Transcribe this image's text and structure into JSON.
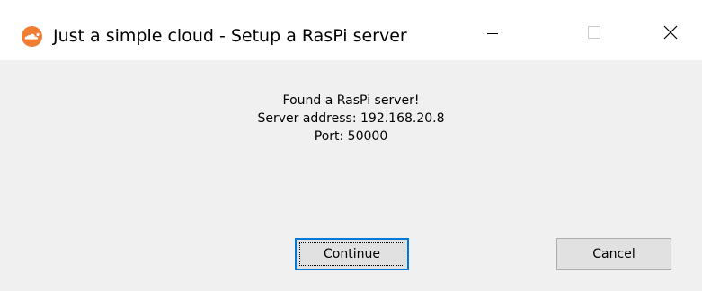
{
  "window": {
    "title": "Just a simple cloud - Setup a RasPi server",
    "app_icon": "cloud-icon",
    "title_bar_background": "#ffffff",
    "client_background": "#f0f0f0",
    "caption_buttons": {
      "minimize": "minimize-icon",
      "maximize": "maximize-icon",
      "maximize_enabled": false,
      "close": "close-icon"
    }
  },
  "message": {
    "line1": "Found a RasPi server!",
    "line2": "Server address: 192.168.20.8",
    "line3": "Port: 50000"
  },
  "buttons": {
    "continue_label": "Continue",
    "continue_focused": true,
    "cancel_label": "Cancel"
  },
  "colors": {
    "icon_orange": "#f07d33",
    "focus_accent": "#0078d7",
    "button_face": "#e1e1e1",
    "button_border": "#adadad"
  }
}
